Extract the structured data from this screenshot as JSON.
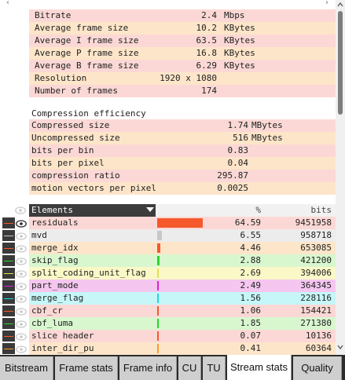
{
  "stats": [
    {
      "label": "Bitrate",
      "value": "2.4",
      "unit": "Mbps"
    },
    {
      "label": "Average frame size",
      "value": "10.2",
      "unit": "KBytes"
    },
    {
      "label": "Average I frame size",
      "value": "63.5",
      "unit": "KBytes"
    },
    {
      "label": "Average P frame size",
      "value": "16.8",
      "unit": "KBytes"
    },
    {
      "label": "Average B frame size",
      "value": "6.29",
      "unit": "KBytes"
    },
    {
      "label": "Resolution",
      "value": "1920 x 1080",
      "unit": ""
    },
    {
      "label": "Number of frames",
      "value": "174",
      "unit": ""
    }
  ],
  "compression": {
    "title": "Compression efficiency",
    "rows": [
      {
        "label": "Compressed size",
        "value": "1.74",
        "unit": "MBytes"
      },
      {
        "label": "Uncompressed size",
        "value": "516",
        "unit": "MBytes"
      },
      {
        "label": "bits per bin",
        "value": "0.83",
        "unit": ""
      },
      {
        "label": "bits per pixel",
        "value": "0.04",
        "unit": ""
      },
      {
        "label": "compression ratio",
        "value": "295.87",
        "unit": ""
      },
      {
        "label": "motion vectors per pixel",
        "value": "0.0025",
        "unit": ""
      }
    ]
  },
  "elements": {
    "header": {
      "title": "Elements",
      "pct": "%",
      "bits": "bits"
    },
    "rows": [
      {
        "name": "residuals",
        "pct": "64.59",
        "bits": "9451958",
        "share": 0.6459,
        "bar_color": "#f5582a",
        "row_color": "#fbd8d5",
        "line_color": "#f5582a"
      },
      {
        "name": "mvd",
        "pct": "6.55",
        "bits": "958718",
        "share": 0.0655,
        "bar_color": "#c8c8c8",
        "row_color": "#ececec",
        "line_color": "#c8c8c8"
      },
      {
        "name": "merge_idx",
        "pct": "4.46",
        "bits": "653085",
        "share": 0.0446,
        "bar_color": "#f5582a",
        "row_color": "#fde5c9",
        "line_color": "#f5582a"
      },
      {
        "name": "skip_flag",
        "pct": "2.88",
        "bits": "421200",
        "share": 0.0288,
        "bar_color": "#2ad52a",
        "row_color": "#d8f7cf",
        "line_color": "#2ad52a"
      },
      {
        "name": "split_coding_unit_flag",
        "pct": "2.69",
        "bits": "394006",
        "share": 0.0269,
        "bar_color": "#e4e04c",
        "row_color": "#fbf8c8",
        "line_color": "#e4e04c"
      },
      {
        "name": "part_mode",
        "pct": "2.49",
        "bits": "364345",
        "share": 0.0249,
        "bar_color": "#e21fd3",
        "row_color": "#f5c6ef",
        "line_color": "#e21fd3"
      },
      {
        "name": "merge_flag",
        "pct": "1.56",
        "bits": "228116",
        "share": 0.0156,
        "bar_color": "#21d6e3",
        "row_color": "#c6f6f8",
        "line_color": "#21d6e3"
      },
      {
        "name": "cbf_cr",
        "pct": "1.06",
        "bits": "154421",
        "share": 0.0106,
        "bar_color": "#f5582a",
        "row_color": "#fbd8d5",
        "line_color": "#f5582a"
      },
      {
        "name": "cbf_luma",
        "pct": "1.85",
        "bits": "271380",
        "share": 0.0185,
        "bar_color": "#2ad52a",
        "row_color": "#d8f7cf",
        "line_color": "#2ad52a"
      },
      {
        "name": "slice header",
        "pct": "0.07",
        "bits": "10136",
        "share": 0.0007,
        "bar_color": "#f5582a",
        "row_color": "#fbd8d5",
        "line_color": "#f5582a"
      },
      {
        "name": "inter_dir_pu",
        "pct": "0.41",
        "bits": "60364",
        "share": 0.0041,
        "bar_color": "#f5a02a",
        "row_color": "#fde5c9",
        "line_color": "#f5a02a"
      }
    ]
  },
  "tabs": [
    {
      "label": "Bitstream",
      "active": false
    },
    {
      "label": "Frame stats",
      "active": false
    },
    {
      "label": "Frame info",
      "active": false
    },
    {
      "label": "CU",
      "active": false
    },
    {
      "label": "TU",
      "active": false
    },
    {
      "label": "Stream stats",
      "active": true
    },
    {
      "label": "Quality",
      "active": false
    }
  ],
  "icons": {
    "scroll_left": "chevron-left-icon",
    "scroll_right": "chevron-right-icon",
    "visibility": "eye-icon",
    "scroll_up": "chevron-up-icon",
    "scroll_down": "chevron-down-icon"
  }
}
